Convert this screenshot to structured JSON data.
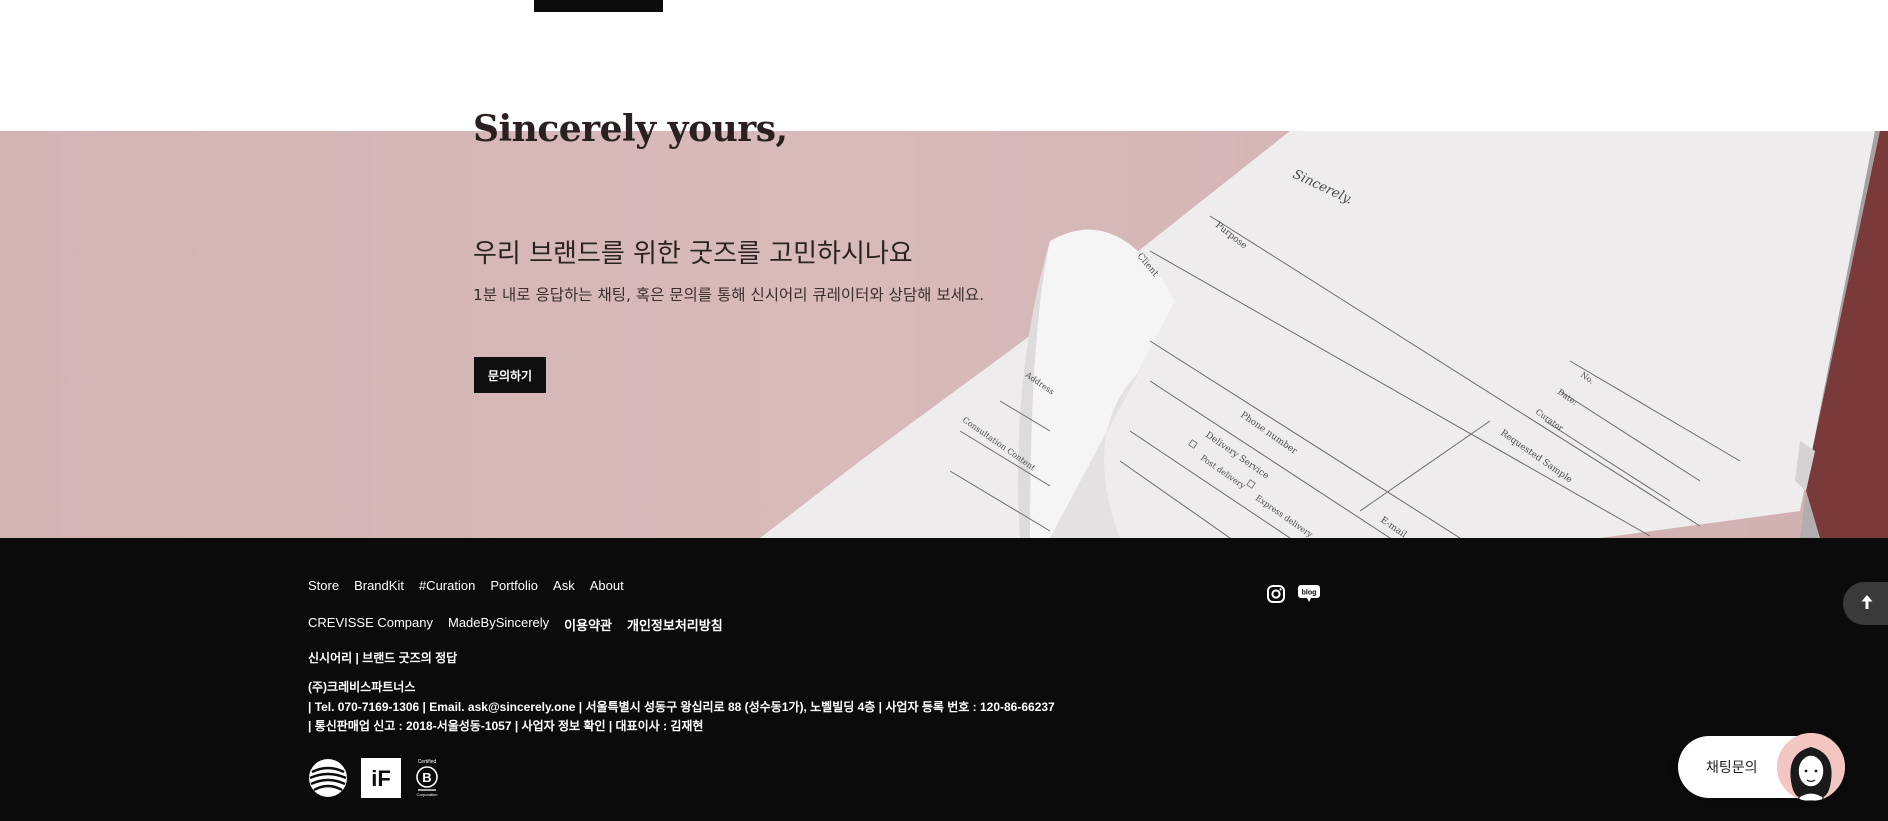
{
  "hero": {
    "title": "Sincerely yours,",
    "headline": "우리 브랜드를 위한 굿즈를 고민하시나요",
    "subtext": "1분 내로 응답하는 채팅, 혹은 문의를 통해 신시어리 큐레이터와 상담해 보세요.",
    "cta_label": "문의하기",
    "image_text": {
      "logo": "Sincerely.",
      "purpose": "Purpose",
      "client": "Client",
      "phone": "Phone number",
      "delivery": "Delivery Service",
      "post": "Post delivery",
      "express": "Express delivery",
      "email": "E-mail",
      "requested": "Requested Sample",
      "no": "No.",
      "date": "Date:",
      "curator": "Curator",
      "consultation": "Consultation Content",
      "address": "Address"
    }
  },
  "footer": {
    "nav_primary": [
      "Store",
      "BrandKit",
      "#Curation",
      "Portfolio",
      "Ask",
      "About"
    ],
    "nav_secondary": [
      {
        "label": "CREVISSE Company",
        "strong": false
      },
      {
        "label": "MadeBySincerely",
        "strong": false
      },
      {
        "label": "이용약관",
        "strong": false
      },
      {
        "label": "개인정보처리방침",
        "strong": true
      }
    ],
    "tagline": "신시어리 | 브랜드 굿즈의 정답",
    "company_name": "(주)크레비스파트너스",
    "company_line1": "| Tel. 070-7169-1306 | Email. ask@sincerely.one | 서울특별시 성동구 왕십리로 88 (성수동1가), 노벨빌딩 4층 | 사업자 등록 번호 : 120-86-66237",
    "company_line2": "| 통신판매업 신고 : 2018-서울성동-1057 | 사업자 정보 확인  |  대표이사 : 김재현",
    "cert_logos": [
      "red-dot-award-logo",
      "if-design-award-logo",
      "certified-b-corporation-logo"
    ],
    "social": [
      "instagram-icon",
      "blog-icon"
    ],
    "blog_label": "blog",
    "bcorp": {
      "top": "Certified",
      "bottom": "Corporation"
    },
    "if_label": "iF"
  },
  "widgets": {
    "scroll_top_icon": "arrow-up-icon",
    "chat_label": "채팅문의"
  },
  "colors": {
    "hero_bg": "#d5b7b8",
    "footer_bg": "#0b0b0b",
    "button_bg": "#0f0f0f",
    "paper": "#efedee"
  }
}
